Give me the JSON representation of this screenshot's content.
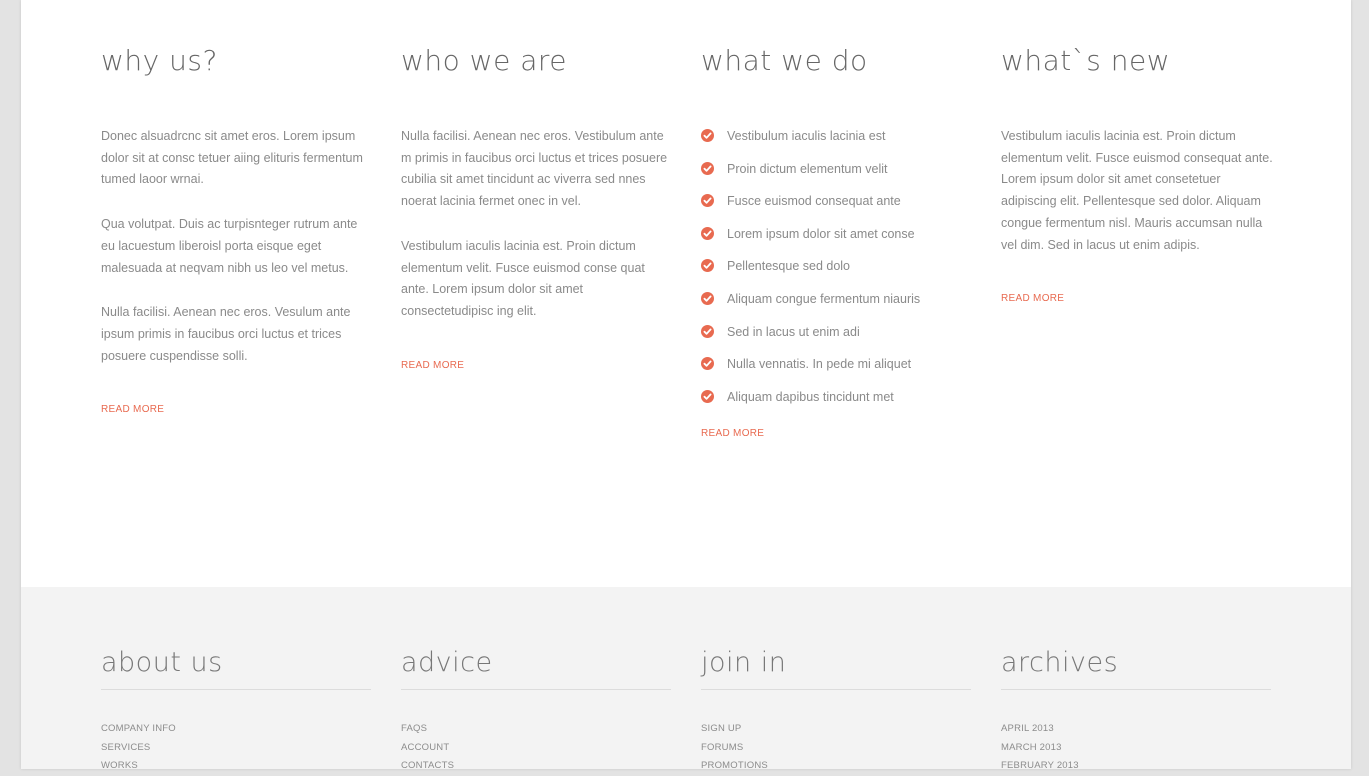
{
  "colors": {
    "accent": "#e86a50",
    "text": "#8a8a8a",
    "heading": "#666666",
    "footer_bg": "#f3f3f3"
  },
  "sections": [
    {
      "title": "why us?",
      "paragraphs": [
        "Donec alsuadrcnc sit amet eros. Lorem ipsum dolor sit at consc tetuer aiing elituris fermentum tumed laoor wrnai.",
        "Qua volutpat. Duis ac turpisnteger rutrum ante eu lacuestum liberoisl porta eisque eget malesuada at neqvam nibh us leo vel metus.",
        "Nulla facilisi. Aenean nec eros. Vesulum ante ipsum primis in faucibus orci luctus et trices posuere cuspendisse solli."
      ],
      "read_more": "READ MORE"
    },
    {
      "title": "who we are",
      "paragraphs": [
        "Nulla facilisi. Aenean nec eros. Vestibulum ante m primis in faucibus orci luctus et trices posuere cubilia sit amet tincidunt ac viverra sed nnes noerat lacinia fermet onec in vel.",
        "Vestibulum iaculis lacinia est. Proin dictum elementum velit. Fusce euismod conse quat ante. Lorem ipsum dolor sit amet consectetudipisc ing elit."
      ],
      "read_more": "READ MORE"
    },
    {
      "title": "what we do",
      "items": [
        "Vestibulum iaculis lacinia est",
        "Proin dictum elementum velit",
        "Fusce euismod consequat ante",
        "Lorem ipsum dolor sit amet conse",
        "Pellentesque sed dolo",
        "Aliquam congue fermentum niauris",
        "Sed in lacus ut enim adi",
        "Nulla vennatis. In pede mi aliquet",
        "Aliquam dapibus tincidunt met"
      ],
      "read_more": "READ MORE"
    },
    {
      "title": "what`s new",
      "paragraphs": [
        "Vestibulum iaculis lacinia est. Proin dictum elementum velit. Fusce euismod consequat ante. Lorem ipsum dolor sit amet consetetuer adipiscing elit. Pellentesque sed dolor. Aliquam congue fermentum nisl. Mauris accumsan nulla vel dim. Sed in lacus ut enim adipis."
      ],
      "read_more": "READ MORE"
    }
  ],
  "footer": [
    {
      "title": "about us",
      "links": [
        "COMPANY INFO",
        "SERVICES",
        "WORKS"
      ]
    },
    {
      "title": "advice",
      "links": [
        "FAQS",
        "ACCOUNT",
        "CONTACTS"
      ]
    },
    {
      "title": "join in",
      "links": [
        "SIGN UP",
        "FORUMS",
        "PROMOTIONS"
      ]
    },
    {
      "title": "archives",
      "links": [
        "APRIL 2013",
        "MARCH 2013",
        "FEBRUARY 2013"
      ]
    }
  ]
}
